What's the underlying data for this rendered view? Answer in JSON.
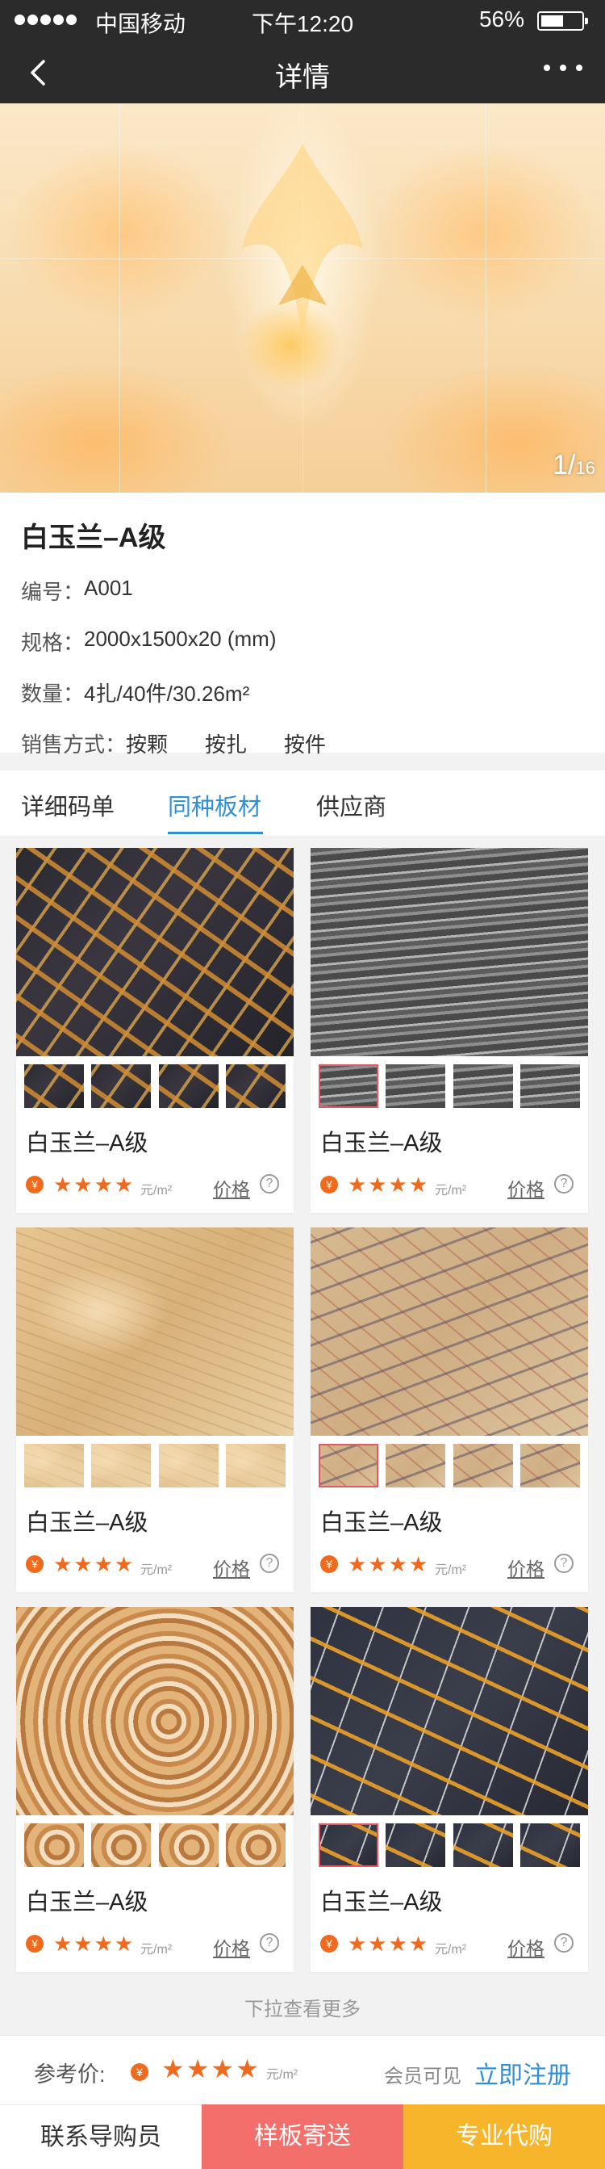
{
  "status_bar": {
    "carrier": "中国移动",
    "time": "下午12:20",
    "battery_percent_label": "56%",
    "battery_level": 0.56
  },
  "nav": {
    "title": "详情"
  },
  "hero": {
    "current": "1",
    "separator": "/",
    "total": "16"
  },
  "product": {
    "name": "白玉兰–A级",
    "code_label": "编号：",
    "code": "A001",
    "spec_label": "规格：",
    "spec": "2000x1500x20 (mm)",
    "qty_label": "数量：",
    "qty": "4扎/40件/30.26m²",
    "sale_label": "销售方式：",
    "sale_methods": [
      "按颗",
      "按扎",
      "按件"
    ]
  },
  "tabs": [
    "详细码单",
    "同种板材",
    "供应商"
  ],
  "active_tab": 1,
  "cards": [
    {
      "name": "白玉兰–A级",
      "stars": "★★★★",
      "unit": "元/m²",
      "price_label": "价格",
      "help": "?",
      "texture": "gold"
    },
    {
      "name": "白玉兰–A级",
      "stars": "★★★★",
      "unit": "元/m²",
      "price_label": "价格",
      "help": "?",
      "texture": "grey"
    },
    {
      "name": "白玉兰–A级",
      "stars": "★★★★",
      "unit": "元/m²",
      "price_label": "价格",
      "help": "?",
      "texture": "beige"
    },
    {
      "name": "白玉兰–A级",
      "stars": "★★★★",
      "unit": "元/m²",
      "price_label": "价格",
      "help": "?",
      "texture": "brownvein"
    },
    {
      "name": "白玉兰–A级",
      "stars": "★★★★",
      "unit": "元/m²",
      "price_label": "价格",
      "help": "?",
      "texture": "onyx"
    },
    {
      "name": "白玉兰–A级",
      "stars": "★★★★",
      "unit": "元/m²",
      "price_label": "价格",
      "help": "?",
      "texture": "blackgold"
    }
  ],
  "yen_symbol": "¥",
  "load_more": "下拉查看更多",
  "ref_bar": {
    "label": "参考价:",
    "stars": "★★★★",
    "unit": "元/m²",
    "visibility": "会员可见",
    "register": "立即注册"
  },
  "actions": [
    "联系导购员",
    "样板寄送",
    "专业代购"
  ],
  "colors": {
    "accent_blue": "#2f8fd8",
    "orange": "#f06a1d",
    "btn_red": "#f26f6b",
    "btn_yellow": "#f7b52b",
    "bar_dark": "#2b2b2b"
  },
  "icons": [
    "signal-dots-icon",
    "battery-icon",
    "back-arrow-icon",
    "more-dots-icon",
    "yen-icon",
    "star-icon",
    "help-circle-icon"
  ]
}
